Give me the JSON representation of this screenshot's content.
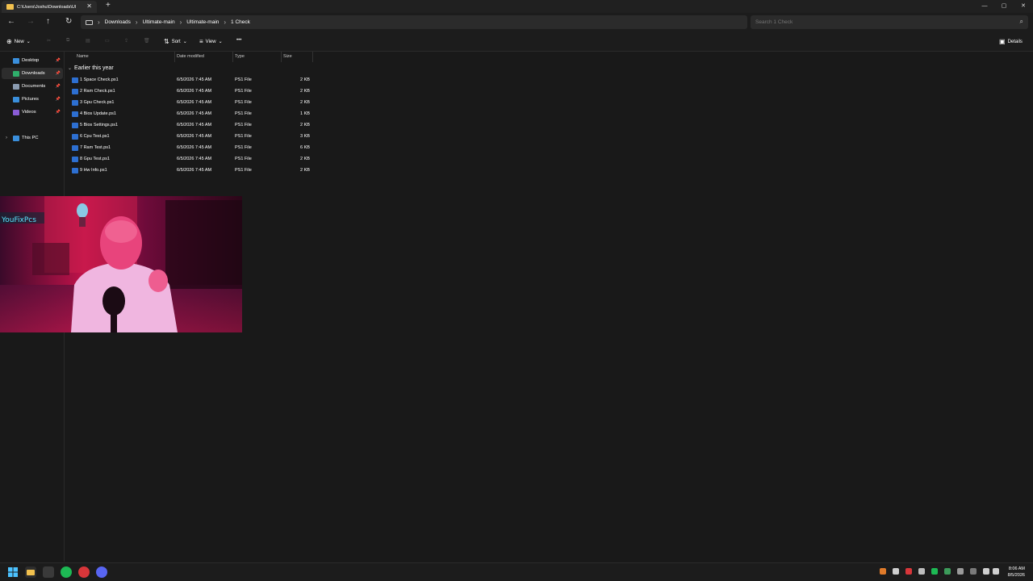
{
  "window": {
    "tab_title": "C:\\Users\\Joshu\\Downloads\\Ul",
    "tab_close": "✕",
    "new_tab": "+",
    "minimize": "—",
    "maximize": "▢",
    "close": "✕"
  },
  "address": {
    "crumbs": [
      "Downloads",
      "Ultimate-main",
      "Ultimate-main",
      "1 Check"
    ],
    "separator": "›",
    "search_placeholder": "Search 1 Check"
  },
  "toolbar": {
    "new_label": "New",
    "sort_label": "Sort",
    "view_label": "View",
    "more_label": "•••",
    "details_label": "Details"
  },
  "sidebar": {
    "items": [
      {
        "label": "Desktop",
        "color": "#3a8fdc"
      },
      {
        "label": "Downloads",
        "color": "#2fae6b"
      },
      {
        "label": "Documents",
        "color": "#8a9bb0"
      },
      {
        "label": "Pictures",
        "color": "#3a8fdc"
      },
      {
        "label": "Videos",
        "color": "#8a5cd6"
      },
      {
        "label": "This PC",
        "color": "#3a8fdc"
      }
    ]
  },
  "columns": {
    "name": "Name",
    "date": "Date modified",
    "type": "Type",
    "size": "Size"
  },
  "group": {
    "label": "Earlier this year"
  },
  "files": [
    {
      "name": "1 Space Check.ps1",
      "date": "6/5/2026 7:45 AM",
      "type": "PS1 File",
      "size": "2 KB"
    },
    {
      "name": "2 Ram Check.ps1",
      "date": "6/5/2026 7:45 AM",
      "type": "PS1 File",
      "size": "2 KB"
    },
    {
      "name": "3 Gpu Check.ps1",
      "date": "6/5/2026 7:45 AM",
      "type": "PS1 File",
      "size": "2 KB"
    },
    {
      "name": "4 Bios Update.ps1",
      "date": "6/5/2026 7:45 AM",
      "type": "PS1 File",
      "size": "1 KB"
    },
    {
      "name": "5 Bios Settings.ps1",
      "date": "6/5/2026 7:45 AM",
      "type": "PS1 File",
      "size": "2 KB"
    },
    {
      "name": "6 Cpu Test.ps1",
      "date": "6/5/2026 7:45 AM",
      "type": "PS1 File",
      "size": "3 KB"
    },
    {
      "name": "7 Ram Test.ps1",
      "date": "6/5/2026 7:45 AM",
      "type": "PS1 File",
      "size": "6 KB"
    },
    {
      "name": "8 Gpu Test.ps1",
      "date": "6/5/2026 7:45 AM",
      "type": "PS1 File",
      "size": "2 KB"
    },
    {
      "name": "9 Hw Info.ps1",
      "date": "6/5/2026 7:45 AM",
      "type": "PS1 File",
      "size": "2 KB"
    }
  ],
  "taskbar": {
    "time": "8:06 AM",
    "date": "8/5/2026"
  }
}
